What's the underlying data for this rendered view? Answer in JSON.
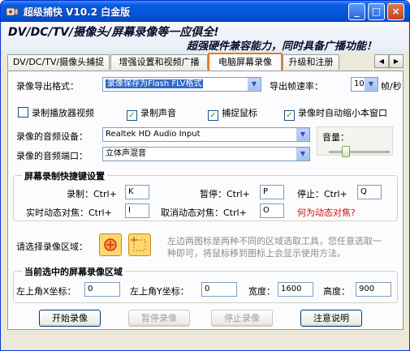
{
  "window": {
    "title": "超级捕快 V10.2 白金版",
    "minimize": "_",
    "maximize": "□",
    "close": "×"
  },
  "banner": {
    "line1": "DV/DC/TV/摄像头/屏幕录像等一应俱全!",
    "line2": "超强硬件兼容能力，同时具备广播功能！"
  },
  "tabs": [
    {
      "label": "DV/DC/TV/摄像头捕捉",
      "active": false
    },
    {
      "label": "增强设置和视频广播",
      "active": false
    },
    {
      "label": "电脑屏幕录像",
      "active": true
    },
    {
      "label": "升级和注册",
      "active": false
    }
  ],
  "tab_scroll": {
    "left": "◀",
    "right": "▶"
  },
  "format": {
    "label": "录像导出格式：",
    "value": "录像保存为Flash FLV格式"
  },
  "fps": {
    "label": "导出帧速率：",
    "value": "10",
    "unit": "帧/秒"
  },
  "options": [
    {
      "label": "录制播放器视频",
      "checked": false
    },
    {
      "label": "录制声音",
      "checked": true
    },
    {
      "label": "捕捉鼠标",
      "checked": true
    },
    {
      "label": "录像时自动缩小本窗口",
      "checked": true
    }
  ],
  "audio_device": {
    "label": "录像的音频设备：",
    "value": "Realtek HD Audio Input"
  },
  "audio_port": {
    "label": "录像的音频端口：",
    "value": "立体声混音"
  },
  "volume": {
    "label": "音量：",
    "level": 0.25
  },
  "hotkeys": {
    "title": "屏幕录制快捷键设置",
    "record_label": "录制：Ctrl+",
    "record_key": "K",
    "pause_label": "暂停：Ctrl+",
    "pause_key": "P",
    "stop_label": "停止：Ctrl+",
    "stop_key": "Q",
    "track_label": "实时动态对焦：Ctrl+",
    "track_key": "I",
    "cancel_track_label": "取消动态对焦：Ctrl+",
    "cancel_track_key": "O",
    "help_link": "何为动态对焦?"
  },
  "region": {
    "label": "请选择录像区域：",
    "hint": "左边两图标是两种不同的区域选取工具，您任意选取一种即可，将鼠标移到图标上会显示使用方法。"
  },
  "current_region": {
    "title": "当前选中的屏幕录像区域",
    "x_label": "左上角X坐标：",
    "x_value": "0",
    "y_label": "左上角Y坐标：",
    "y_value": "0",
    "width_label": "宽度：",
    "width_value": "1600",
    "height_label": "高度：",
    "height_value": "900"
  },
  "actions": {
    "start": "开始录像",
    "pause": "暂停录像",
    "stop": "停止录像",
    "help": "注意说明"
  },
  "colors": {
    "title_bar": "#0553d6",
    "active_tab_outline": "#e87a1d",
    "selected_combo": "#316ac5",
    "link": "#d0100e"
  }
}
